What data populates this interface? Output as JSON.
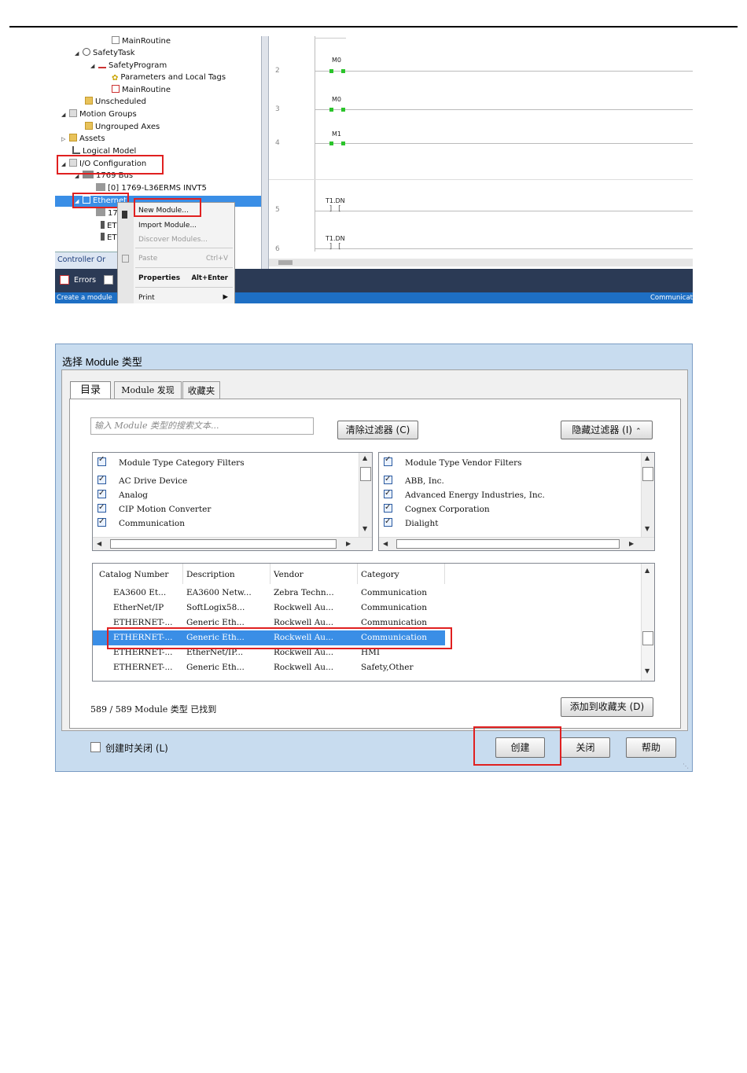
{
  "screenshot1": {
    "tree": [
      {
        "label": "MainRoutine"
      },
      {
        "label": "SafetyTask"
      },
      {
        "label": "SafetyProgram"
      },
      {
        "label": "Parameters and Local Tags"
      },
      {
        "label": "MainRoutine"
      },
      {
        "label": "Unscheduled"
      },
      {
        "label": "Motion Groups"
      },
      {
        "label": "Ungrouped Axes"
      },
      {
        "label": "Assets"
      },
      {
        "label": "Logical Model"
      },
      {
        "label": "I/O Configuration"
      },
      {
        "label": "1769 Bus"
      },
      {
        "label": "[0] 1769-L36ERMS INVT5"
      },
      {
        "label": "Ethernet"
      },
      {
        "label": "17"
      },
      {
        "label": "ET"
      },
      {
        "label": "ET"
      }
    ],
    "controller_tab": "Controller Or",
    "context_menu": {
      "new_module": "New Module...",
      "import_module": "Import Module...",
      "discover_modules": "Discover Modules...",
      "paste": "Paste",
      "paste_shortcut": "Ctrl+V",
      "properties": "Properties",
      "properties_shortcut": "Alt+Enter",
      "print": "Print"
    },
    "rungs": [
      {
        "number": "2",
        "tag": "M0"
      },
      {
        "number": "3",
        "tag": "M0"
      },
      {
        "number": "4",
        "tag": "M1"
      },
      {
        "number": "5",
        "tag": "T1.DN"
      },
      {
        "number": "6",
        "tag": "T1.DN"
      }
    ],
    "errors_label": "Errors",
    "status_left": "Create a module",
    "status_right": "Communicat"
  },
  "dialog": {
    "title": "选择 Module 类型",
    "tabs": [
      "目录",
      "Module 发现",
      "收藏夹"
    ],
    "search_placeholder": "输入 Module 类型的搜索文本...",
    "clear_filters_button": "清除过滤器 (C)",
    "hide_filters_button": "隐藏过滤器 (I)",
    "category_filters": {
      "header": "Module Type Category Filters",
      "items": [
        "AC Drive Device",
        "Analog",
        "CIP Motion Converter",
        "Communication"
      ]
    },
    "vendor_filters": {
      "header": "Module Type Vendor Filters",
      "items": [
        "ABB, Inc.",
        "Advanced Energy Industries, Inc.",
        "Cognex Corporation",
        "Dialight"
      ]
    },
    "table": {
      "columns": [
        "Catalog Number",
        "Description",
        "Vendor",
        "Category"
      ],
      "rows": [
        [
          "EA3600 Et...",
          "EA3600 Netw...",
          "Zebra Techn...",
          "Communication"
        ],
        [
          "EtherNet/IP",
          "SoftLogix58...",
          "Rockwell Au...",
          "Communication"
        ],
        [
          "ETHERNET-...",
          "Generic Eth...",
          "Rockwell Au...",
          "Communication"
        ],
        [
          "ETHERNET-...",
          "Generic Eth...",
          "Rockwell Au...",
          "Communication"
        ],
        [
          "ETHERNET-...",
          "EtherNet/IP...",
          "Rockwell Au...",
          "HMI"
        ],
        [
          "ETHERNET-...",
          "Generic Eth...",
          "Rockwell Au...",
          "Safety,Other"
        ]
      ],
      "selected_row": 3
    },
    "found_text": "589 / 589 Module 类型 已找到",
    "add_favorites_button": "添加到收藏夹 (D)",
    "close_on_create_label": "创建时关闭 (L)",
    "create_button": "创建",
    "close_button": "关闭",
    "help_button": "帮助"
  },
  "colors": {
    "highlight_red": "#e02020",
    "selection_blue": "#3a8ee6",
    "dialog_bg": "#c8dcef"
  }
}
